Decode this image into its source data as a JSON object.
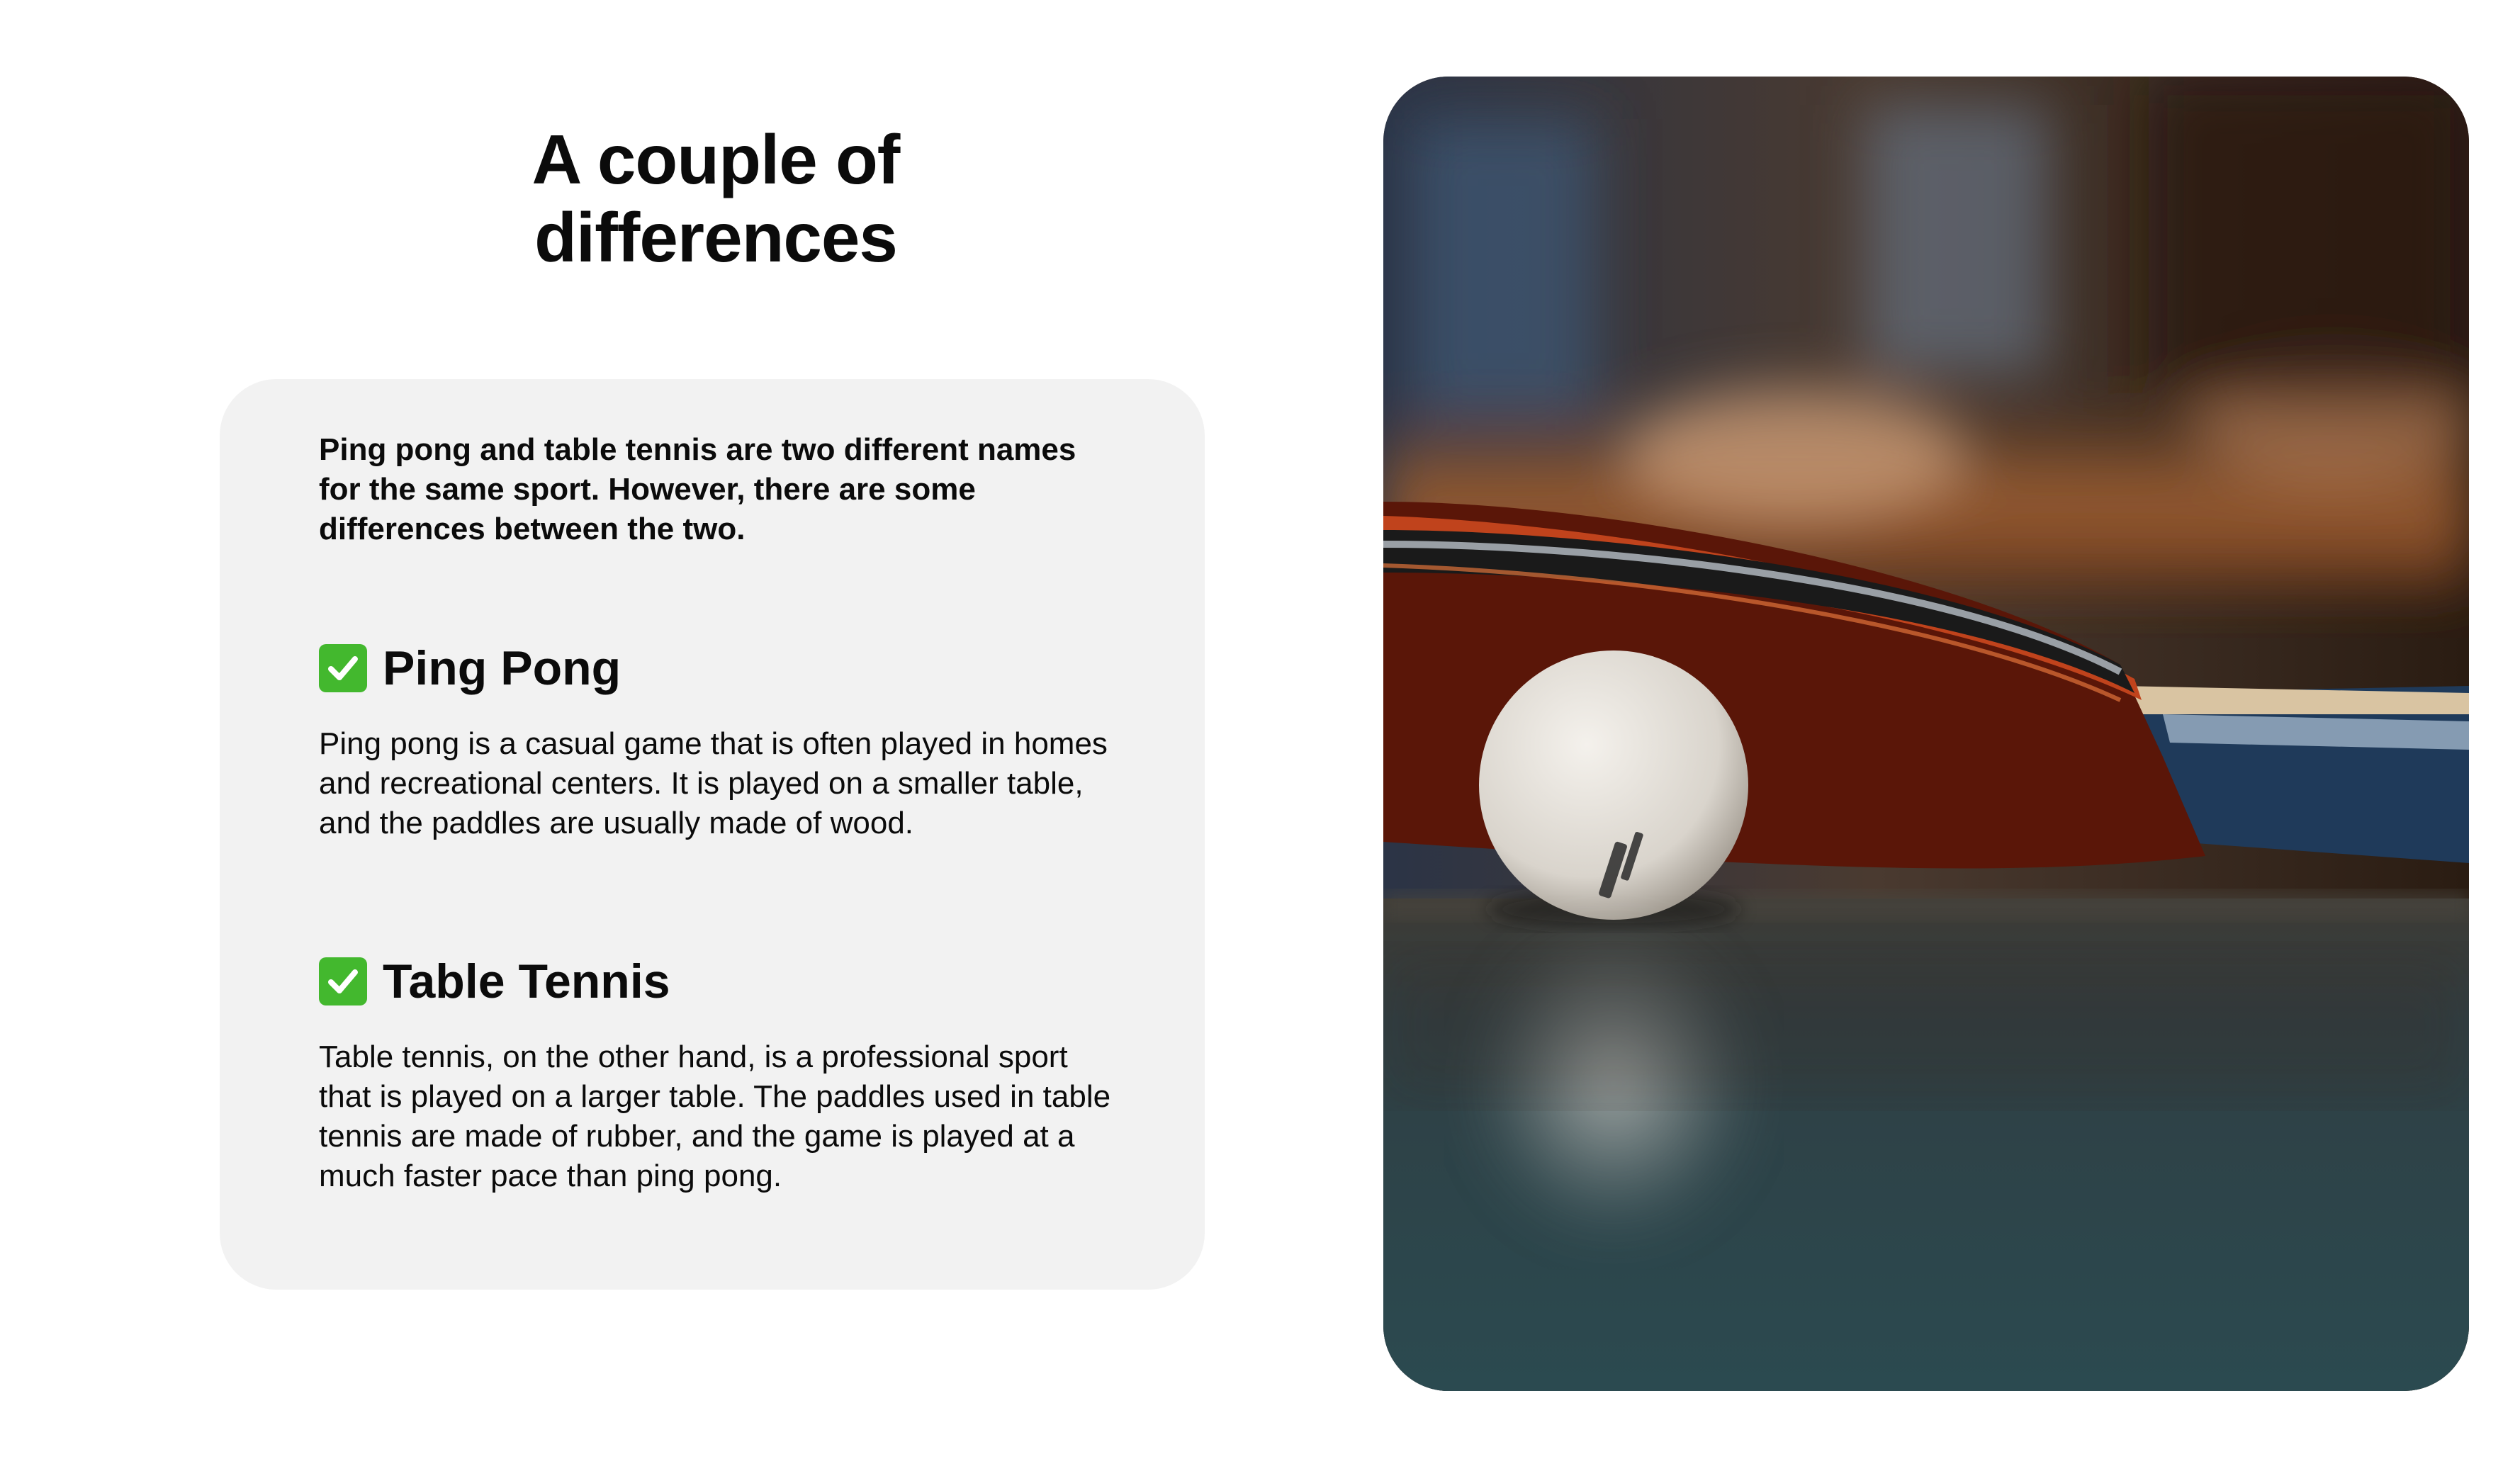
{
  "slide": {
    "title": "A couple of differences",
    "intro": "Ping pong and table tennis are two different names for the same sport. However, there are some differences between the two.",
    "sections": [
      {
        "icon": "check-box-icon",
        "heading": "Ping Pong",
        "body": "Ping pong is a casual game that is often played in homes and recreational centers. It is played on a smaller table, and the paddles are usually made of wood."
      },
      {
        "icon": "check-box-icon",
        "heading": "Table Tennis",
        "body": "Table tennis, on the other hand, is a professional sport that is played on a larger table. The paddles used in table tennis are made of rubber, and the game is played at a much faster pace than ping pong."
      }
    ]
  },
  "colors": {
    "card_background": "#f2f2f2",
    "check_green": "#43b82e",
    "text": "#0b0b0b"
  },
  "photo": {
    "subject": "ping-pong-paddle-and-ball-photo"
  }
}
